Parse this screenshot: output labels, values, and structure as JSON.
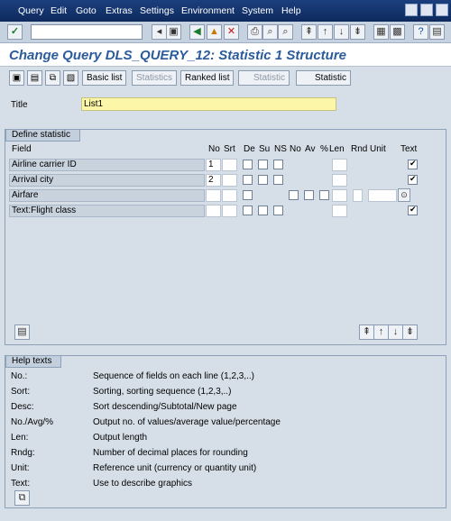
{
  "menu": [
    "Query",
    "Edit",
    "Goto",
    "Extras",
    "Settings",
    "Environment",
    "System",
    "Help"
  ],
  "page_title": "Change Query DLS_QUERY_12: Statistic 1 Structure",
  "app_toolbar": {
    "basic_list": "Basic list",
    "statistics": "Statistics",
    "ranked_list": "Ranked list",
    "statistic_dis": "Statistic",
    "statistic": "Statistic"
  },
  "title_label": "Title",
  "title_value": "List1",
  "define": {
    "label": "Define statistic",
    "headers": {
      "field": "Field",
      "no": "No",
      "srt": "Srt",
      "de": "De",
      "su": "Su",
      "ns": "NS",
      "no2": "No",
      "av": "Av",
      "pct": "%",
      "len": "Len",
      "rnd": "Rnd",
      "unit": "Unit",
      "text": "Text"
    },
    "rows": [
      {
        "name": "Airline carrier ID",
        "no": "1",
        "text_checked": true
      },
      {
        "name": "Arrival city",
        "no": "2",
        "text_checked": true
      },
      {
        "name": "Airfare",
        "no": "",
        "text_checked": false
      },
      {
        "name": "Text:Flight class",
        "no": "",
        "text_checked": true
      }
    ]
  },
  "help": {
    "label": "Help texts",
    "items": [
      {
        "key": "No.:",
        "desc": "Sequence of fields on each line (1,2,3,..)"
      },
      {
        "key": "Sort:",
        "desc": "Sorting, sorting sequence (1,2,3,..)"
      },
      {
        "key": "Desc:",
        "desc": "Sort descending/Subtotal/New page"
      },
      {
        "key": "No./Avg/%",
        "desc": "Output no. of values/average value/percentage"
      },
      {
        "key": "Len:",
        "desc": "Output length"
      },
      {
        "key": "Rndg:",
        "desc": "Number of decimal places for rounding"
      },
      {
        "key": "Unit:",
        "desc": "Reference unit (currency or quantity unit)"
      },
      {
        "key": "Text:",
        "desc": "Use to describe graphics"
      }
    ]
  }
}
